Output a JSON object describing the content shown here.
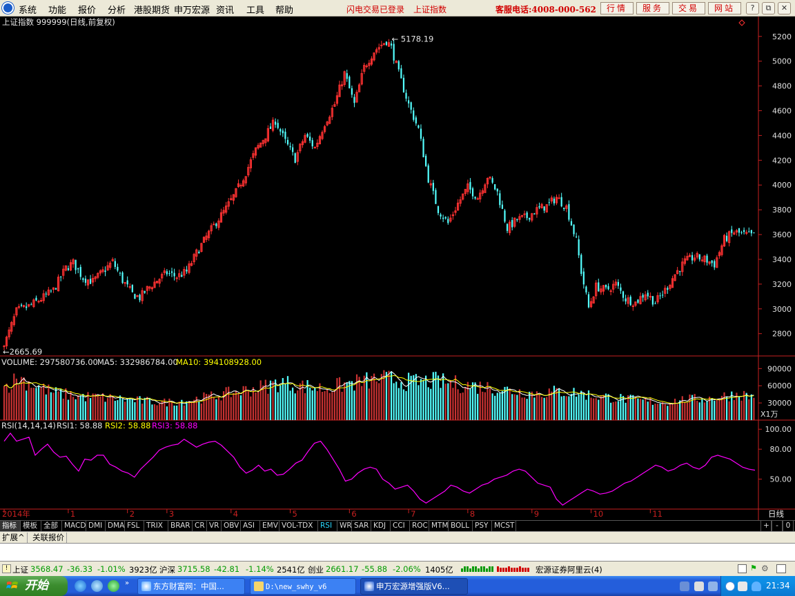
{
  "menubar": {
    "items": [
      "系统",
      "功能",
      "报价",
      "分析",
      "港股期货",
      "申万宏源",
      "资讯",
      "工具",
      "帮助"
    ],
    "flash_status": "闪电交易已登录",
    "current_index": "上证指数",
    "hotline": "客服电话:4008-000-562",
    "buttons": [
      "行情",
      "服务",
      "交易",
      "网站"
    ]
  },
  "chart_data": {
    "type": "candlestick",
    "title": "上证指数  999999(日线,前复权)",
    "price_axis": {
      "ticks": [
        2800,
        3000,
        3200,
        3400,
        3600,
        3800,
        4000,
        4200,
        4400,
        4600,
        4800,
        5000,
        5200
      ],
      "ylim": [
        2620,
        5260
      ]
    },
    "annotations": [
      {
        "label": "5178.19",
        "type": "high"
      },
      {
        "label": "2665.69",
        "type": "low"
      }
    ],
    "x_labels": [
      "2014年",
      "1",
      "2",
      "3",
      "4",
      "5",
      "6",
      "7",
      "8",
      "9",
      "10",
      "11"
    ],
    "period_label": "日线",
    "close_anchors": [
      [
        0,
        2700
      ],
      [
        5,
        2980
      ],
      [
        10,
        3020
      ],
      [
        15,
        3080
      ],
      [
        20,
        3150
      ],
      [
        25,
        3330
      ],
      [
        28,
        3370
      ],
      [
        32,
        3250
      ],
      [
        36,
        3220
      ],
      [
        40,
        3300
      ],
      [
        44,
        3380
      ],
      [
        48,
        3230
      ],
      [
        52,
        3120
      ],
      [
        55,
        3090
      ],
      [
        58,
        3160
      ],
      [
        62,
        3230
      ],
      [
        66,
        3290
      ],
      [
        70,
        3260
      ],
      [
        74,
        3300
      ],
      [
        78,
        3450
      ],
      [
        82,
        3580
      ],
      [
        86,
        3700
      ],
      [
        90,
        3810
      ],
      [
        94,
        3940
      ],
      [
        98,
        4100
      ],
      [
        102,
        4280
      ],
      [
        106,
        4400
      ],
      [
        110,
        4520
      ],
      [
        114,
        4350
      ],
      [
        118,
        4210
      ],
      [
        122,
        4400
      ],
      [
        126,
        4300
      ],
      [
        130,
        4500
      ],
      [
        134,
        4650
      ],
      [
        138,
        4900
      ],
      [
        142,
        4650
      ],
      [
        146,
        4950
      ],
      [
        150,
        5080
      ],
      [
        154,
        5150
      ],
      [
        156,
        5178
      ],
      [
        160,
        4900
      ],
      [
        164,
        4650
      ],
      [
        168,
        4450
      ],
      [
        172,
        4050
      ],
      [
        176,
        3800
      ],
      [
        180,
        3690
      ],
      [
        184,
        3850
      ],
      [
        188,
        3980
      ],
      [
        192,
        3900
      ],
      [
        196,
        4070
      ],
      [
        200,
        3940
      ],
      [
        204,
        3650
      ],
      [
        208,
        3720
      ],
      [
        212,
        3740
      ],
      [
        216,
        3800
      ],
      [
        220,
        3830
      ],
      [
        224,
        3900
      ],
      [
        228,
        3820
      ],
      [
        232,
        3550
      ],
      [
        234,
        3300
      ],
      [
        237,
        3010
      ],
      [
        240,
        3180
      ],
      [
        244,
        3150
      ],
      [
        248,
        3200
      ],
      [
        252,
        3080
      ],
      [
        256,
        3050
      ],
      [
        260,
        3130
      ],
      [
        264,
        3050
      ],
      [
        268,
        3150
      ],
      [
        272,
        3280
      ],
      [
        276,
        3380
      ],
      [
        280,
        3420
      ],
      [
        284,
        3400
      ],
      [
        288,
        3360
      ],
      [
        292,
        3560
      ],
      [
        296,
        3620
      ],
      [
        300,
        3600
      ],
      [
        304,
        3590
      ]
    ],
    "volume": {
      "label": "VOLUME: 297580736.00",
      "ma5_label": "MA5: 332986784.00",
      "ma10_label": "MA10: 394108928.00",
      "ticks": [
        30000,
        60000,
        90000
      ],
      "ylim": [
        0,
        100000
      ],
      "unit": "X1万",
      "anchors": [
        [
          0,
          58000
        ],
        [
          6,
          74000
        ],
        [
          12,
          62000
        ],
        [
          20,
          48000
        ],
        [
          30,
          42000
        ],
        [
          45,
          38000
        ],
        [
          55,
          34000
        ],
        [
          65,
          31000
        ],
        [
          75,
          35000
        ],
        [
          85,
          42000
        ],
        [
          95,
          50000
        ],
        [
          105,
          58000
        ],
        [
          112,
          66000
        ],
        [
          120,
          60000
        ],
        [
          130,
          55000
        ],
        [
          140,
          64000
        ],
        [
          150,
          70000
        ],
        [
          156,
          72000
        ],
        [
          165,
          66000
        ],
        [
          175,
          68000
        ],
        [
          185,
          62000
        ],
        [
          195,
          58000
        ],
        [
          205,
          52000
        ],
        [
          215,
          47000
        ],
        [
          225,
          50000
        ],
        [
          232,
          48000
        ],
        [
          240,
          42000
        ],
        [
          250,
          38000
        ],
        [
          260,
          33000
        ],
        [
          268,
          31000
        ],
        [
          276,
          36000
        ],
        [
          286,
          38000
        ],
        [
          292,
          42000
        ],
        [
          298,
          46000
        ],
        [
          304,
          40000
        ]
      ]
    },
    "rsi": {
      "label": "RSI(14,14,14)",
      "rsi1": "RSI1: 58.88",
      "rsi2": "RSI2: 58.88",
      "rsi3": "RSI3: 58.88",
      "ticks": [
        50.0,
        80.0,
        100.0
      ],
      "ylim": [
        20,
        105
      ],
      "series": [
        88,
        96,
        88,
        90,
        92,
        74,
        80,
        85,
        77,
        72,
        73,
        65,
        58,
        70,
        69,
        74,
        74,
        65,
        62,
        58,
        56,
        52,
        60,
        66,
        72,
        79,
        82,
        84,
        85,
        90,
        86,
        82,
        85,
        87,
        88,
        84,
        78,
        72,
        62,
        56,
        59,
        64,
        58,
        60,
        54,
        55,
        60,
        66,
        69,
        78,
        86,
        88,
        80,
        70,
        60,
        48,
        50,
        56,
        60,
        62,
        60,
        50,
        46,
        40,
        42,
        44,
        38,
        30,
        26,
        30,
        34,
        38,
        44,
        42,
        38,
        36,
        40,
        44,
        46,
        50,
        52,
        54,
        58,
        60,
        58,
        52,
        46,
        44,
        42,
        30,
        24,
        28,
        32,
        36,
        40,
        38,
        35,
        36,
        38,
        42,
        46,
        48,
        52,
        56,
        60,
        64,
        62,
        58,
        60,
        64,
        66,
        62,
        60,
        64,
        72,
        74,
        72,
        70,
        66,
        62,
        60,
        59
      ]
    },
    "colors": {
      "up": "#ff3232",
      "down": "#54ffff",
      "rsi": "#ff00ff",
      "ma5": "#ffffff",
      "ma10": "#ffff00",
      "axis": "#c82020"
    }
  },
  "tabs": [
    "指标",
    "模板",
    "全部",
    "MACD",
    "DMI",
    "DMA",
    "FSL",
    "TRIX",
    "BRAR",
    "CR",
    "VR",
    "OBV",
    "ASI",
    "EMV",
    "VOL-TDX",
    "RSI",
    "WR",
    "SAR",
    "KDJ",
    "CCI",
    "ROC",
    "MTM",
    "BOLL",
    "PSY",
    "MCST"
  ],
  "tab_controls": [
    "+",
    "-",
    "0"
  ],
  "subtabs": [
    "扩展^",
    "关联报价"
  ],
  "status": {
    "sh": {
      "name": "上证",
      "price": "3568.47",
      "chg": "-36.33",
      "pct": "-1.01%",
      "amt": "3923亿"
    },
    "hs": {
      "name": "沪深",
      "price": "3715.58",
      "chg": "-42.81",
      "pct": "-1.14%",
      "amt": "2541亿"
    },
    "cy": {
      "name": "创业",
      "price": "2661.17",
      "chg": "-55.88",
      "pct": "-2.06%",
      "amt": "1405亿"
    },
    "server": "宏源证券阿里云(4)"
  },
  "taskbar": {
    "start": "开始",
    "tasks": [
      "东方财富网：中国...",
      "D:\\new_swhy_v6",
      "申万宏源增强版V6..."
    ],
    "clock": "21:34"
  }
}
